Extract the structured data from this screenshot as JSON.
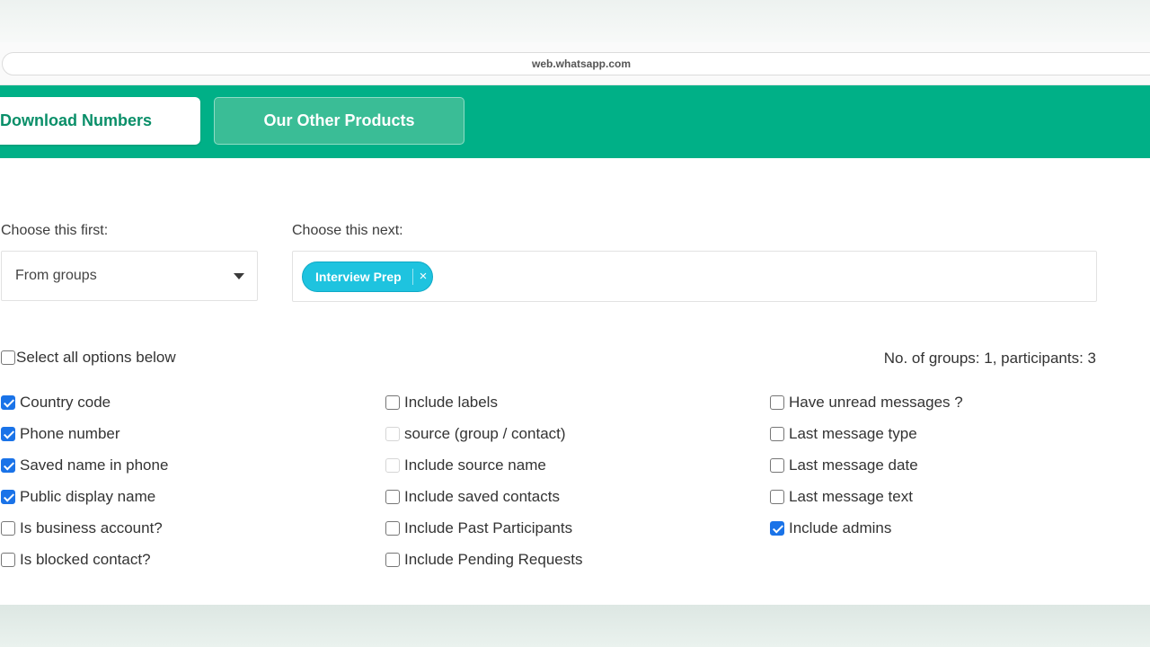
{
  "browser": {
    "url": "web.whatsapp.com"
  },
  "nav": {
    "download_label": "Download Numbers",
    "other_products_label": "Our Other Products"
  },
  "selectors": {
    "first_label": "Choose this first:",
    "first_value": "From groups",
    "next_label": "Choose this next:",
    "chips": [
      {
        "label": "Interview Prep",
        "remove_glyph": "×"
      }
    ]
  },
  "select_all": {
    "label": "Select all options below",
    "checked": false
  },
  "summary": {
    "text": "No. of groups: 1, participants: 3"
  },
  "options": {
    "col1": [
      {
        "label": "Country code",
        "checked": true
      },
      {
        "label": "Phone number",
        "checked": true
      },
      {
        "label": "Saved name in phone",
        "checked": true
      },
      {
        "label": "Public display name",
        "checked": true
      },
      {
        "label": "Is business account?",
        "checked": false
      },
      {
        "label": "Is blocked contact?",
        "checked": false
      }
    ],
    "col2": [
      {
        "label": "Include labels",
        "checked": false
      },
      {
        "label": "source (group / contact)",
        "checked": false,
        "disabled": true
      },
      {
        "label": "Include source name",
        "checked": false,
        "disabled": true
      },
      {
        "label": "Include saved contacts",
        "checked": false
      },
      {
        "label": "Include Past Participants",
        "checked": false
      },
      {
        "label": "Include Pending Requests",
        "checked": false
      }
    ],
    "col3": [
      {
        "label": "Have unread messages ?",
        "checked": false
      },
      {
        "label": "Last message type",
        "checked": false
      },
      {
        "label": "Last message date",
        "checked": false
      },
      {
        "label": "Last message text",
        "checked": false
      },
      {
        "label": "Include admins",
        "checked": true
      }
    ]
  },
  "colors": {
    "brand_green": "#00b087",
    "chip_cyan": "#1ec3df",
    "checkbox_blue": "#1a73e8"
  }
}
